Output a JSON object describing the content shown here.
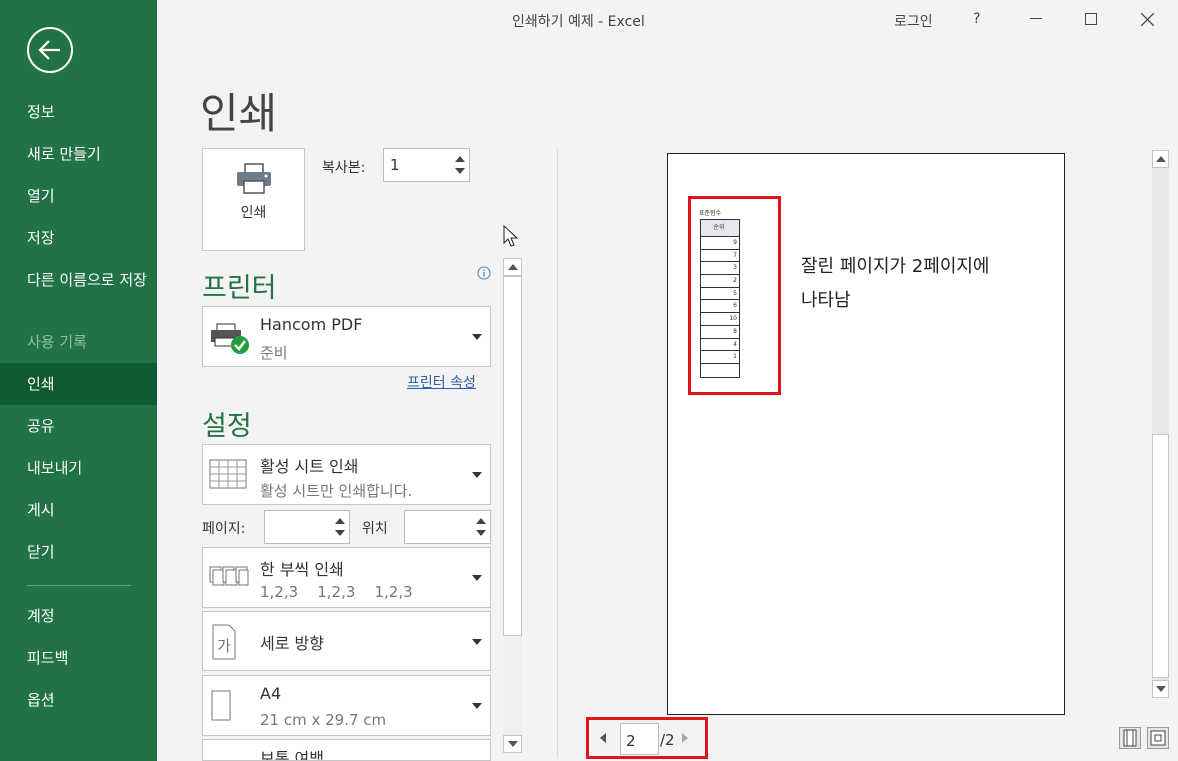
{
  "window": {
    "title": "인쇄하기 예제  -  Excel",
    "signin": "로그인",
    "help": "?"
  },
  "sidebar": {
    "items": [
      {
        "label": "정보"
      },
      {
        "label": "새로 만들기"
      },
      {
        "label": "열기"
      },
      {
        "label": "저장"
      },
      {
        "label": "다른 이름으로 저장"
      },
      {
        "label": "사용 기록"
      },
      {
        "label": "인쇄"
      },
      {
        "label": "공유"
      },
      {
        "label": "내보내기"
      },
      {
        "label": "게시"
      },
      {
        "label": "닫기"
      },
      {
        "label": "계정"
      },
      {
        "label": "피드백"
      },
      {
        "label": "옵션"
      }
    ]
  },
  "print": {
    "title": "인쇄",
    "button_label": "인쇄",
    "copies_label": "복사본:",
    "copies_value": "1",
    "printer_heading": "프린터",
    "printer_name": "Hancom PDF",
    "printer_status": "준비",
    "printer_props": "프린터 속성",
    "settings_heading": "설정",
    "scope_title": "활성 시트 인쇄",
    "scope_desc": "활성 시트만 인쇄합니다.",
    "pages_label": "페이지:",
    "to_label": "위치",
    "collate_title": "한 부씩 인쇄",
    "collate_desc": "1,2,3    1,2,3    1,2,3",
    "orientation": "세로 방향",
    "paper_title": "A4",
    "paper_desc": "21 cm x 29.7 cm",
    "margins": "보통 여백"
  },
  "preview": {
    "sheet_title": "표준점수",
    "col_header": "순위",
    "rows": [
      "9",
      "7",
      "3",
      "2",
      "5",
      "6",
      "10",
      "8",
      "4",
      "1",
      ""
    ],
    "annotation_line1": "잘린 페이지가 2페이지에",
    "annotation_line2": "나타남",
    "current_page": "2",
    "total_pages": "/2"
  },
  "colors": {
    "accent": "#217346",
    "highlight": "#e0121a"
  }
}
